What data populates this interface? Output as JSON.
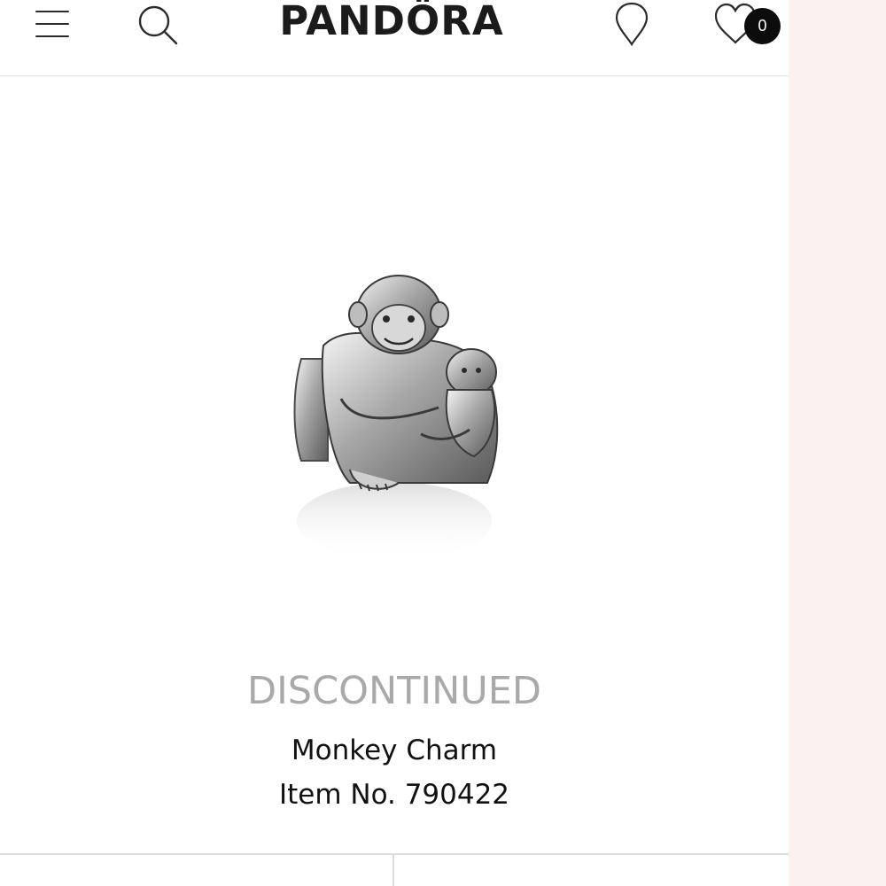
{
  "header": {
    "logo": "PANDÖRA",
    "menu_icon": "hamburger-menu-icon",
    "search_icon": "search-icon",
    "store_icon": "location-pin-icon",
    "wishlist_icon": "heart-icon",
    "wishlist_count": "0"
  },
  "product": {
    "image_icon": "monkey-charm-image",
    "status": "DISCONTINUED",
    "name": "Monkey Charm",
    "item_number": "Item No. 790422"
  },
  "colors": {
    "side_panel": "#fbf1ef",
    "status_text": "#a9a9a9",
    "badge": "#0c0c0c"
  }
}
